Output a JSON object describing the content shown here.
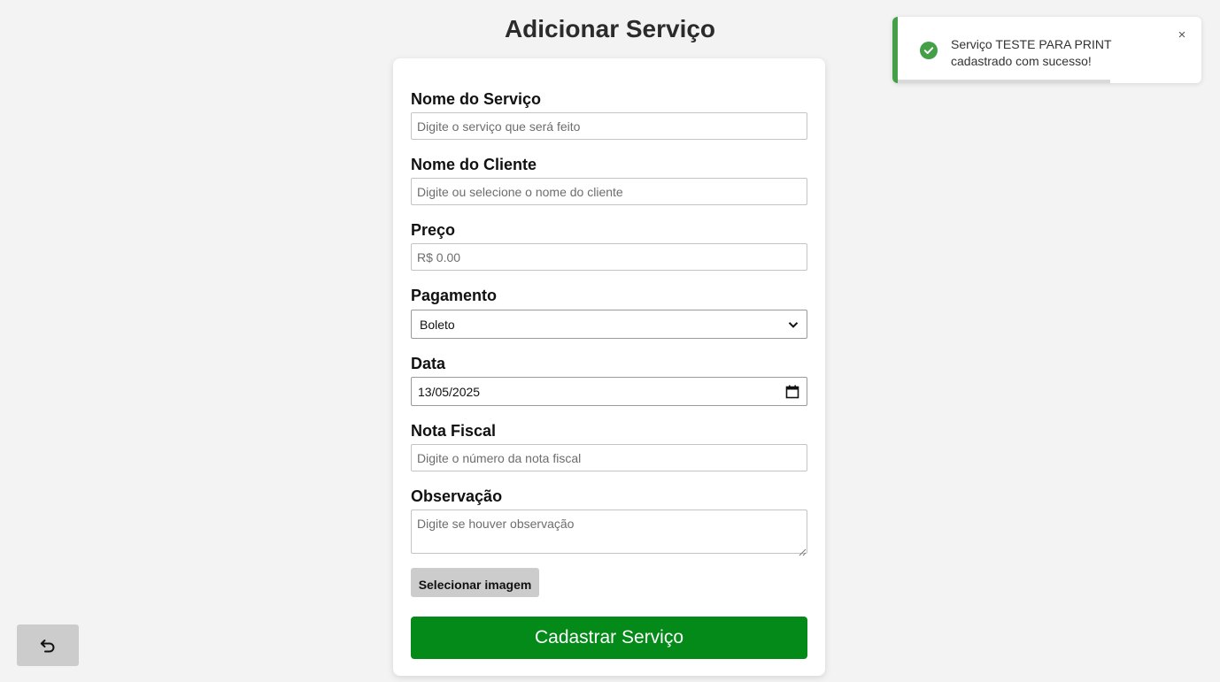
{
  "page": {
    "title": "Adicionar Serviço"
  },
  "form": {
    "service_name": {
      "label": "Nome do Serviço",
      "placeholder": "Digite o serviço que será feito"
    },
    "client_name": {
      "label": "Nome do Cliente",
      "placeholder": "Digite ou selecione o nome do cliente"
    },
    "price": {
      "label": "Preço",
      "placeholder": "R$ 0.00"
    },
    "payment": {
      "label": "Pagamento",
      "value": "Boleto"
    },
    "date": {
      "label": "Data",
      "value": "13/05/2025"
    },
    "invoice": {
      "label": "Nota Fiscal",
      "placeholder": "Digite o número da nota fiscal"
    },
    "observation": {
      "label": "Observação",
      "placeholder": "Digite se houver observação"
    },
    "select_image_label": "Selecionar imagem",
    "submit_label": "Cadastrar Serviço"
  },
  "toast": {
    "message": "Serviço TESTE PARA PRINT cadastrado com sucesso!",
    "close_glyph": "×",
    "icon": "check-circle-icon",
    "progress_remaining": 0.7,
    "accent_color": "#43a047"
  },
  "back_button": {
    "icon": "undo-arrow-icon"
  },
  "colors": {
    "primary": "#038a18",
    "background": "#f3f3f3",
    "secondary_button": "#cccccc"
  }
}
